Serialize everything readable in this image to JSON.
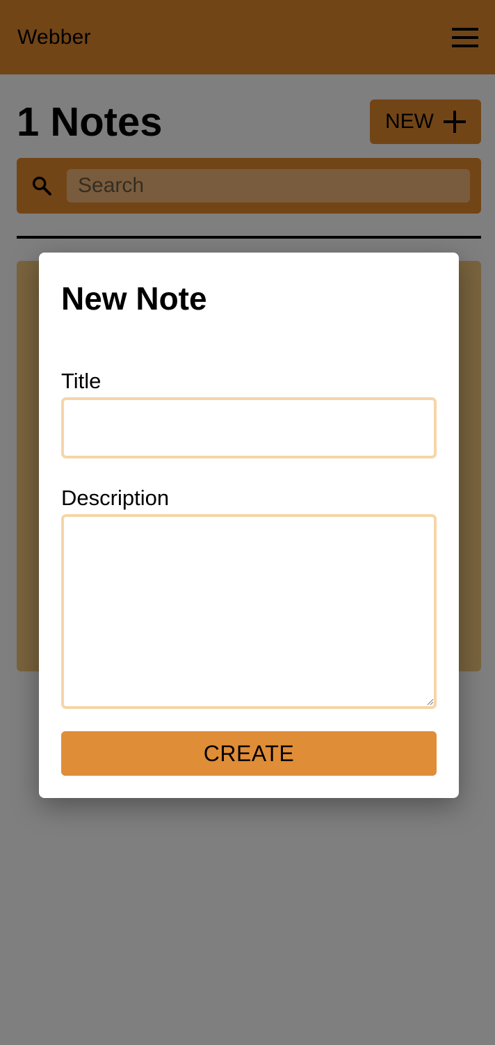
{
  "app": {
    "brand": "Webber",
    "menu_icon": "hamburger-menu-icon"
  },
  "notes": {
    "count_label": "1 Notes",
    "new_button_label": "NEW",
    "new_button_icon": "plus-icon"
  },
  "search": {
    "placeholder": "Search",
    "value": "",
    "icon": "search-icon"
  },
  "modal": {
    "title": "New Note",
    "title_field_label": "Title",
    "title_field_value": "",
    "description_field_label": "Description",
    "description_field_value": "",
    "create_button_label": "CREATE"
  },
  "colors": {
    "accent": "#e58b2e",
    "note_card": "#f4c87c",
    "input_border": "#f6d5a8",
    "create_button": "#e08d38",
    "overlay": "rgba(0,0,0,0.5)"
  }
}
